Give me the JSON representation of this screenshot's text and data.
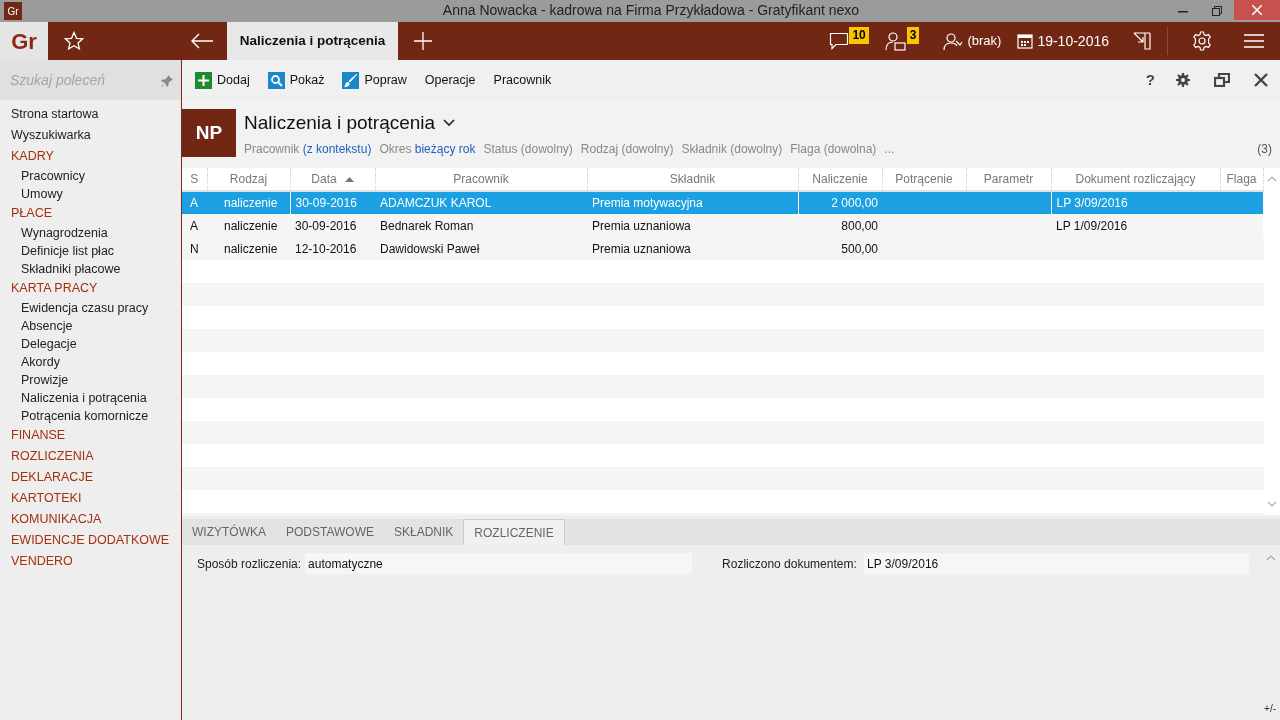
{
  "window": {
    "app_icon": "Gr",
    "title": "Anna Nowacka - kadrowa na Firma Przykładowa - Gratyfikant nexo"
  },
  "appbar": {
    "logo": "Gr",
    "tab": "Naliczenia i potrącenia",
    "messages_count": "10",
    "tasks_count": "3",
    "user": "(brak)",
    "date": "19-10-2016"
  },
  "sidebar": {
    "search_placeholder": "Szukaj poleceń",
    "items": [
      {
        "label": "Strona startowa",
        "kind": "link"
      },
      {
        "label": "Wyszukiwarka",
        "kind": "link"
      },
      {
        "label": "KADRY",
        "kind": "section",
        "children": [
          {
            "label": "Pracownicy"
          },
          {
            "label": "Umowy"
          }
        ]
      },
      {
        "label": "PŁACE",
        "kind": "section",
        "children": [
          {
            "label": "Wynagrodzenia"
          },
          {
            "label": "Definicje list płac"
          },
          {
            "label": "Składniki płacowe"
          }
        ]
      },
      {
        "label": "KARTA PRACY",
        "kind": "section",
        "children": [
          {
            "label": "Ewidencja czasu pracy"
          },
          {
            "label": "Absencje"
          },
          {
            "label": "Delegacje"
          },
          {
            "label": "Akordy"
          },
          {
            "label": "Prowizje"
          },
          {
            "label": "Naliczenia i potrącenia"
          },
          {
            "label": "Potrącenia komornicze"
          }
        ]
      },
      {
        "label": "FINANSE",
        "kind": "section"
      },
      {
        "label": "ROZLICZENIA",
        "kind": "section"
      },
      {
        "label": "DEKLARACJE",
        "kind": "section"
      },
      {
        "label": "KARTOTEKI",
        "kind": "section"
      },
      {
        "label": "KOMUNIKACJA",
        "kind": "section"
      },
      {
        "label": "EWIDENCJE DODATKOWE",
        "kind": "section"
      },
      {
        "label": "VENDERO",
        "kind": "section"
      }
    ]
  },
  "toolbar": {
    "buttons": [
      {
        "label": "Dodaj",
        "kind": "add"
      },
      {
        "label": "Pokaż",
        "kind": "view"
      },
      {
        "label": "Popraw",
        "kind": "edit"
      },
      {
        "label": "Operacje",
        "kind": "plain"
      },
      {
        "label": "Pracownik",
        "kind": "plain"
      }
    ],
    "help": "?"
  },
  "header": {
    "badge": "NP",
    "title": "Naliczenia i potrącenia",
    "filters": [
      {
        "label": "Pracownik",
        "value": "(z kontekstu)",
        "set": true
      },
      {
        "label": "Okres",
        "value": "bieżący rok",
        "set": true
      },
      {
        "label": "Status",
        "value": "(dowolny)",
        "set": false
      },
      {
        "label": "Rodzaj",
        "value": "(dowolny)",
        "set": false
      },
      {
        "label": "Składnik",
        "value": "(dowolny)",
        "set": false
      },
      {
        "label": "Flaga",
        "value": "(dowolna)",
        "set": false
      }
    ],
    "more": "...",
    "count": "(3)"
  },
  "table": {
    "columns": [
      {
        "label": "S",
        "kind": "text",
        "sorted": false
      },
      {
        "label": "Rodzaj",
        "kind": "text",
        "sorted": false
      },
      {
        "label": "Data",
        "kind": "text",
        "sorted": true
      },
      {
        "label": "Pracownik",
        "kind": "text",
        "sorted": false
      },
      {
        "label": "Składnik",
        "kind": "text",
        "sorted": false
      },
      {
        "label": "Naliczenie",
        "kind": "amount",
        "sorted": false
      },
      {
        "label": "Potrącenie",
        "kind": "amount",
        "sorted": false
      },
      {
        "label": "Parametr",
        "kind": "text",
        "sorted": false
      },
      {
        "label": "Dokument rozliczający",
        "kind": "text",
        "sorted": false
      },
      {
        "label": "Flaga",
        "kind": "text",
        "sorted": false
      }
    ],
    "rows": [
      {
        "selected": true,
        "cells": [
          "A",
          "naliczenie",
          "30-09-2016",
          "ADAMCZUK KAROL",
          "Premia motywacyjna",
          "2 000,00",
          null,
          null,
          "LP 3/09/2016",
          null
        ]
      },
      {
        "selected": false,
        "cells": [
          "A",
          "naliczenie",
          "30-09-2016",
          "Bednarek Roman",
          "Premia uznaniowa",
          "800,00",
          null,
          null,
          "LP 1/09/2016",
          null
        ]
      },
      {
        "selected": false,
        "cells": [
          "N",
          "naliczenie",
          "12-10-2016",
          "Dawidowski Paweł",
          "Premia uznaniowa",
          "500,00",
          null,
          null,
          null,
          null
        ]
      }
    ]
  },
  "detail": {
    "tabs": [
      {
        "label": "WIZYTÓWKA",
        "selected": false
      },
      {
        "label": "PODSTAWOWE",
        "selected": false
      },
      {
        "label": "SKŁADNIK",
        "selected": false
      },
      {
        "label": "ROZLICZENIE",
        "selected": true
      }
    ],
    "fields": [
      {
        "label": "Sposób rozliczenia:",
        "value": "automatyczne"
      },
      {
        "label": "Rozliczono dokumentem:",
        "value": "LP 3/09/2016"
      }
    ],
    "footer": "+/-"
  }
}
